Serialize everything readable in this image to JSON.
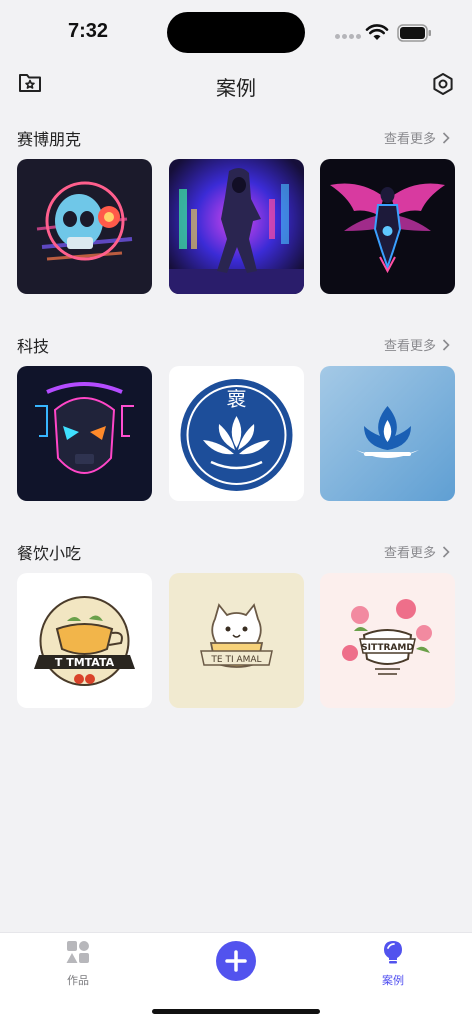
{
  "status": {
    "time": "7:32"
  },
  "nav": {
    "title": "案例"
  },
  "sections": [
    {
      "title": "赛博朋克",
      "more": "查看更多",
      "cards": [
        {
          "icon": "skull-headphones-image"
        },
        {
          "icon": "hooded-figure-image"
        },
        {
          "icon": "winged-silhouette-image"
        }
      ]
    },
    {
      "title": "科技",
      "more": "查看更多",
      "cards": [
        {
          "icon": "robot-head-image"
        },
        {
          "icon": "lotus-emblem-image",
          "text": "褱"
        },
        {
          "icon": "blue-flame-logo-image"
        }
      ]
    },
    {
      "title": "餐饮小吃",
      "more": "查看更多",
      "cards": [
        {
          "icon": "teapot-badge-image",
          "text": "T TMTATA"
        },
        {
          "icon": "cat-cup-logo-image",
          "text": "TE TI AMAL"
        },
        {
          "icon": "floral-teapot-image",
          "text": "SITTRAMD"
        }
      ]
    }
  ],
  "tabbar": {
    "works_label": "作品",
    "cases_label": "案例"
  },
  "colors": {
    "accent": "#5253ee",
    "background": "#f2f2f4"
  }
}
